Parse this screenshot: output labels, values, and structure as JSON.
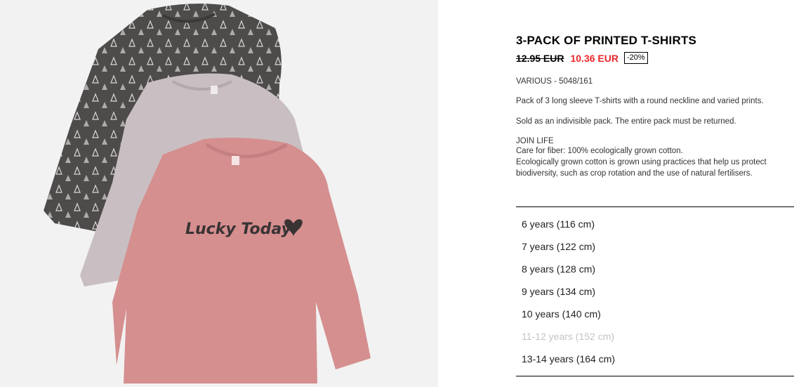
{
  "product": {
    "title": "3-PACK OF PRINTED T-SHIRTS",
    "old_price": "12.95 EUR",
    "new_price": "10.36 EUR",
    "discount": "-20%",
    "reference": "VARIOUS - 5048/161",
    "description": "Pack of 3 long sleeve T-shirts with a round neckline and varied prints.",
    "pack_note": "Sold as an indivisible pack. The entire pack must be returned.",
    "join_life": {
      "title": "JOIN LIFE",
      "lines": [
        "Care for fiber: 100% ecologically grown cotton.",
        "Ecologically grown cotton is grown using practices that help us protect biodiversity, such as crop rotation and the use of natural fertilisers."
      ]
    },
    "print_text": "Lucky Today"
  },
  "sizes": [
    {
      "label": "6 years (116 cm)",
      "available": true
    },
    {
      "label": "7 years (122 cm)",
      "available": true
    },
    {
      "label": "8 years (128 cm)",
      "available": true
    },
    {
      "label": "9 years (134 cm)",
      "available": true
    },
    {
      "label": "10 years (140 cm)",
      "available": true
    },
    {
      "label": "11-12 years (152 cm)",
      "available": false
    },
    {
      "label": "13-14 years (164 cm)",
      "available": true
    }
  ],
  "colors": {
    "sale_red": "#e8262b",
    "image_bg": "#f2f2f2",
    "shirt_dark": "#4e4b4b",
    "shirt_lilac": "#c9bfc2",
    "shirt_pink": "#d58f8f"
  }
}
